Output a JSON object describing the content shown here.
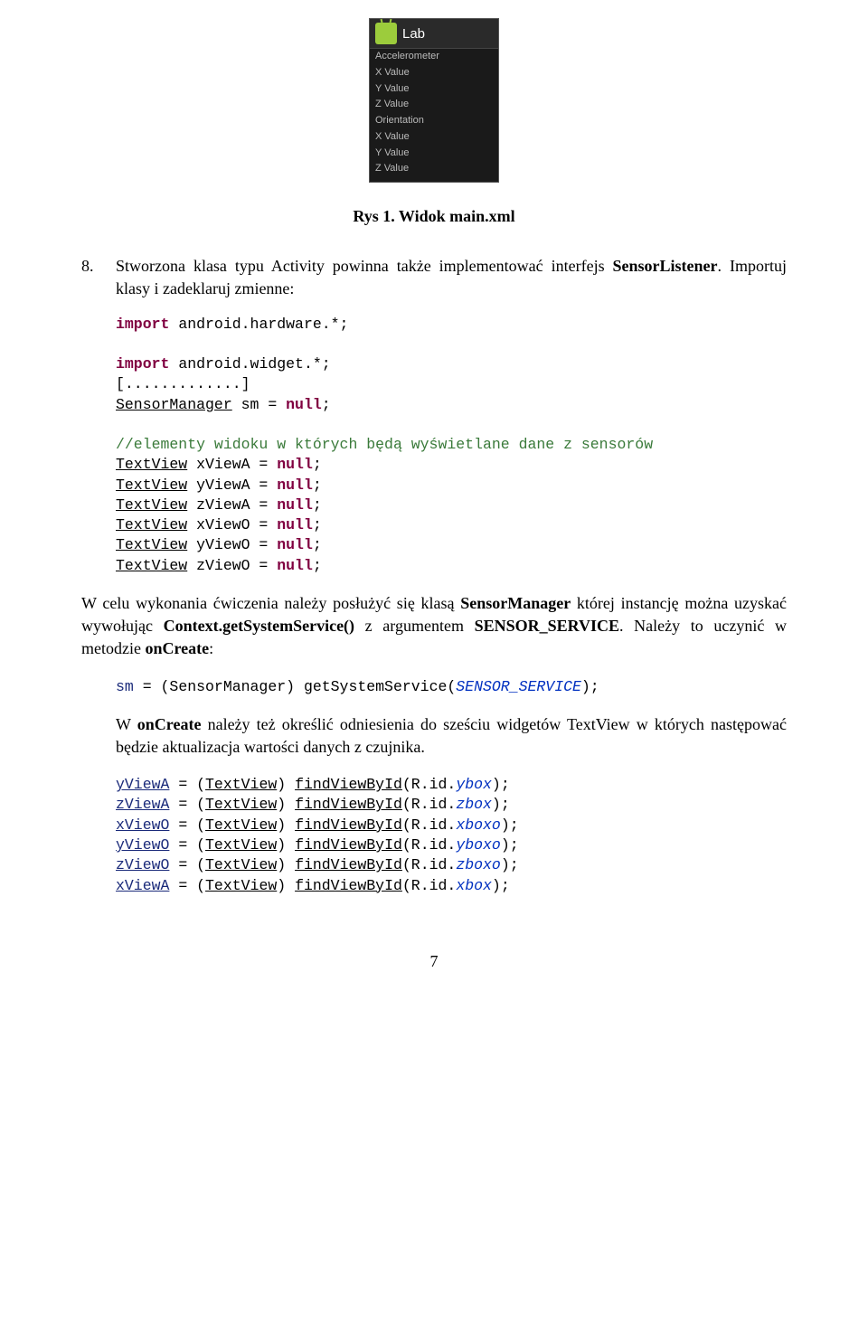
{
  "screenshot": {
    "title": "Lab",
    "lines": [
      "Accelerometer",
      "X Value",
      "Y Value",
      "Z Value",
      "Orientation",
      "X Value",
      "Y Value",
      "Z Value"
    ]
  },
  "caption": "Rys 1. Widok main.xml",
  "item8": {
    "num": "8.",
    "text_a": "Stworzona klasa typu Activity powinna także implementować interfejs ",
    "text_b": "SensorListener",
    "text_c": ". Importuj klasy i zadeklaruj zmienne:"
  },
  "code1": {
    "l1a": "import",
    "l1b": " android.hardware.*;",
    "l2a": "import",
    "l2b": " android.widget.*;",
    "l3": "[.............]",
    "l4a": "SensorManager",
    "l4b": " sm = ",
    "l4c": "null",
    "l4d": ";",
    "l5": "//elementy widoku w których będą wyświetlane dane z sensorów",
    "l6a": "TextView",
    "l6b": " xViewA = ",
    "l6c": "null",
    "l6d": ";",
    "l7a": "TextView",
    "l7b": " yViewA = ",
    "l7c": "null",
    "l7d": ";",
    "l8a": "TextView",
    "l8b": " zViewA = ",
    "l8c": "null",
    "l8d": ";",
    "l9a": "TextView",
    "l9b": " xViewO = ",
    "l9c": "null",
    "l9d": ";",
    "l10a": "TextView",
    "l10b": " yViewO = ",
    "l10c": "null",
    "l10d": ";",
    "l11a": "TextView",
    "l11b": " zViewO = ",
    "l11c": "null",
    "l11d": ";"
  },
  "para1": {
    "a": "W celu wykonania ćwiczenia należy posłużyć się klasą ",
    "b": "SensorManager",
    "c": " której instancję można uzyskać wywołując ",
    "d": "Context.getSystemService()",
    "e": " z argumentem ",
    "f": "SENSOR_SERVICE",
    "g": ". Należy to uczynić w metodzie ",
    "h": "onCreate",
    "i": ":"
  },
  "code2": {
    "a": "sm",
    "b": " = (SensorManager) getSystemService(",
    "c": "SENSOR_SERVICE",
    "d": ");"
  },
  "para2": {
    "a": "W ",
    "b": "onCreate",
    "c": " należy też określić odniesienia do sześciu widgetów  TextView w których następować będzie aktualizacja wartości danych z czujnika."
  },
  "code3": {
    "l1a": "yViewA",
    "l1b": " = (",
    "l1c": "TextView",
    "l1d": ") ",
    "l1e": "findViewById",
    "l1f": "(R.id.",
    "l1g": "ybox",
    "l1h": ");",
    "l2a": "zViewA",
    "l2b": " = (",
    "l2c": "TextView",
    "l2d": ") ",
    "l2e": "findViewById",
    "l2f": "(R.id.",
    "l2g": "zbox",
    "l2h": ");",
    "l3a": "xViewO",
    "l3b": " = (",
    "l3c": "TextView",
    "l3d": ") ",
    "l3e": "findViewById",
    "l3f": "(R.id.",
    "l3g": "xboxo",
    "l3h": ");",
    "l4a": "yViewO",
    "l4b": " = (",
    "l4c": "TextView",
    "l4d": ") ",
    "l4e": "findViewById",
    "l4f": "(R.id.",
    "l4g": "yboxo",
    "l4h": ");",
    "l5a": "zViewO",
    "l5b": " = (",
    "l5c": "TextView",
    "l5d": ") ",
    "l5e": "findViewById",
    "l5f": "(R.id.",
    "l5g": "zboxo",
    "l5h": ");",
    "l6a": "xViewA",
    "l6b": " = (",
    "l6c": "TextView",
    "l6d": ") ",
    "l6e": "findViewById",
    "l6f": "(R.id.",
    "l6g": "xbox",
    "l6h": ");"
  },
  "pagenum": "7"
}
